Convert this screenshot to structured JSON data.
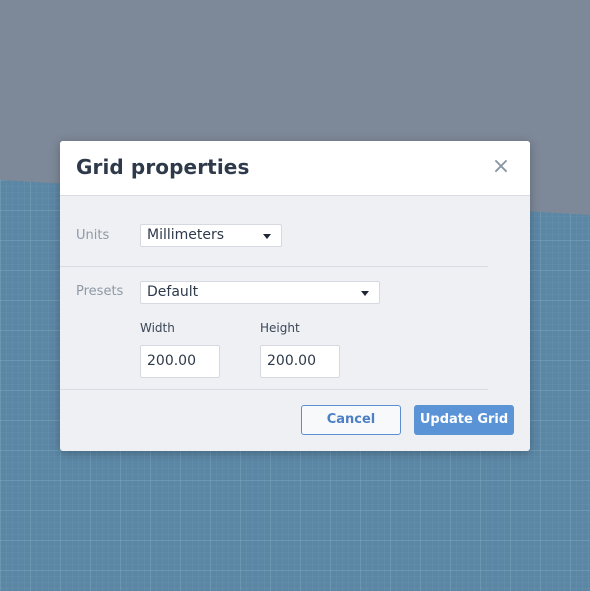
{
  "dialog": {
    "title": "Grid properties",
    "close_glyph": "×",
    "units": {
      "label": "Units",
      "selected": "Millimeters"
    },
    "presets": {
      "label": "Presets",
      "selected": "Default"
    },
    "width": {
      "label": "Width",
      "value": "200.00"
    },
    "height": {
      "label": "Height",
      "value": "200.00"
    },
    "buttons": {
      "cancel": "Cancel",
      "update": "Update Grid"
    }
  },
  "icons": {
    "close": "close-icon",
    "dropdown": "chevron-down-icon"
  },
  "colors": {
    "background": "#7d8898",
    "grid_floor": "#5a87a6",
    "dialog_bg": "#eef0f3",
    "primary": "#5b94d6",
    "title_text": "#2e3a4a"
  }
}
